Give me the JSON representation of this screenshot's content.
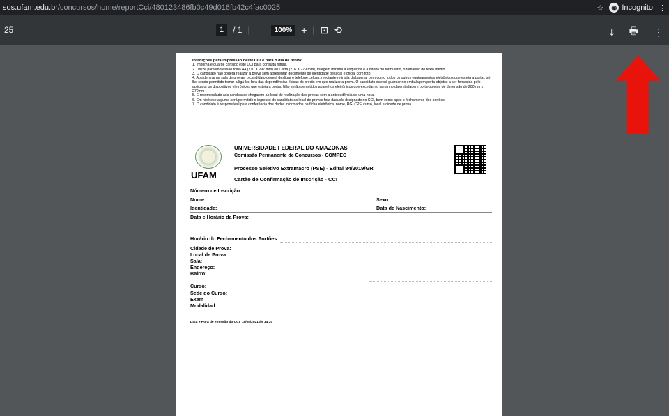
{
  "browser": {
    "url_host": "sos.ufam.edu.br",
    "url_path": "/concursos/home/reportCci/480123486fb0c49d016fb42c4fac0025",
    "incognito_label": "Incognito"
  },
  "pdf_toolbar": {
    "doc_title": "25",
    "page_current": "1",
    "page_total": "/ 1",
    "zoom_out": "—",
    "zoom": "100%",
    "zoom_in": "+",
    "fit_icon": "⊡",
    "rotate_icon": "⟲",
    "download_icon": "⤓",
    "print_icon": "🖶",
    "more_icon": "⋮"
  },
  "instructions": {
    "title": "Instruções para impressão deste CCI e para o dia da prova:",
    "lines": [
      "1. Imprima e guarde consigo este CCI para consulta futura.",
      "2. Utilize para impressão folha A4 (210 X 297 mm) ou Carta (216 X 279 mm), margem mínima à esquerda e à direita do formulário, o tamanho do texto médio.",
      "3. O candidato não poderá realizar a prova sem apresentar documento de identidade pessoal e oficial com foto.",
      "4. Ao adentrar na sala de provas, o candidato deverá desligar o telefone celular, mediante retirada da bateria, bem como todos os outros equipamentos eletrônicos que esteja a portar, só lhe sendo permitido tornar a ligá-los fora das dependências físicas do prédio em que realizar a prova. O candidato deverá guardar no embalagem porta-objetos a ser fornecida pelo aplicador os dispositivos eletrônicos que esteja a portar. Não serão permitidos aparelhos eletrônicos que excedam o tamanho da embalagem porta-objetos de dimensão de 200mm x 270mm",
      "5. É recomendado aos candidatos chegarem ao local de realização das provas com a antecedência de uma hora.",
      "6. Em hipótese alguma será permitido o ingresso do candidato ao local de provas fora daquele designado no CCI, bem como após o fechamento dos portões.",
      "7. O candidato é responsável pela conferência dos dados informados na ficha eletrônica: nome, RG, CPF, curso, local e cidade de prova."
    ]
  },
  "header": {
    "university": "UNIVERSIDADE FEDERAL DO AMAZONAS",
    "commission": "Comissão Permanente de Concursos - COMPEC",
    "process": "Processo Seletivo Extramacro (PSE) - Edital 84/2019/GR",
    "card": "Cartão de Confirmação de Inscrição - CCI",
    "logo_text": "UFAM"
  },
  "fields": {
    "inscricao": "Número de Inscrição:",
    "nome": "Nome:",
    "sexo": "Sexo:",
    "identidade": "Identidade:",
    "nascimento": "Data de Nascimento:",
    "data_prova": "Data e Horário da Prova:",
    "fechamento": "Horário do Fechamento dos Portões:",
    "cidade": "Cidade de Prova:",
    "local": "Local de Prova:",
    "sala": "Sala:",
    "endereco": "Endereço:",
    "bairro": "Bairro:",
    "curso": "Curso:",
    "sede": "Sede do Curso:",
    "exam": "Exam",
    "modalidade": "Modalidad"
  },
  "footer": "Data e Hora de emissão do CCI: 18/05/2021 às 14:30",
  "colors": {
    "annotation_arrow": "#e8140c"
  }
}
